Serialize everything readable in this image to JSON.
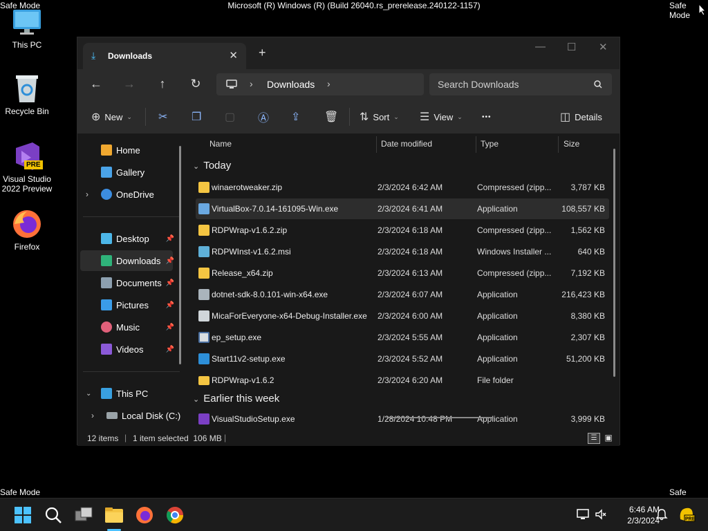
{
  "safe_mode": {
    "top_left": "Safe Mode",
    "top_right": "Safe Mode",
    "bottom_left": "Safe Mode",
    "bottom_right": "Safe Mode"
  },
  "build": "Microsoft (R) Windows (R) (Build 26040.rs_prerelease.240122-1157)",
  "desktop": {
    "this_pc": "This PC",
    "recycle_bin": "Recycle Bin",
    "visual_studio": "Visual Studio 2022 Preview",
    "vs_badge": "PRE",
    "firefox": "Firefox"
  },
  "window": {
    "tab_title": "Downloads",
    "tab_close": "✕",
    "new_tab": "+",
    "minimize": "—",
    "maximize": "☐",
    "close": "✕"
  },
  "nav": {
    "back": "←",
    "forward": "→",
    "up": "↑",
    "refresh": "↻",
    "crumb": "Downloads",
    "search_placeholder": "Search Downloads"
  },
  "cmd": {
    "new": "New",
    "sort": "Sort",
    "view": "View",
    "more": "•••",
    "details": "Details"
  },
  "sidebar": {
    "home": "Home",
    "gallery": "Gallery",
    "onedrive": "OneDrive",
    "desktop": "Desktop",
    "downloads": "Downloads",
    "documents": "Documents",
    "pictures": "Pictures",
    "music": "Music",
    "videos": "Videos",
    "this_pc": "This PC",
    "local_disk": "Local Disk (C:)"
  },
  "columns": {
    "name": "Name",
    "date": "Date modified",
    "type": "Type",
    "size": "Size"
  },
  "groups": {
    "today": "Today",
    "earlier": "Earlier this week"
  },
  "files": [
    {
      "name": "winaerotweaker.zip",
      "date": "2/3/2024 6:42 AM",
      "type": "Compressed (zipp...",
      "size": "3,787 KB"
    },
    {
      "name": "VirtualBox-7.0.14-161095-Win.exe",
      "date": "2/3/2024 6:41 AM",
      "type": "Application",
      "size": "108,557 KB"
    },
    {
      "name": "RDPWrap-v1.6.2.zip",
      "date": "2/3/2024 6:18 AM",
      "type": "Compressed (zipp...",
      "size": "1,562 KB"
    },
    {
      "name": "RDPWInst-v1.6.2.msi",
      "date": "2/3/2024 6:18 AM",
      "type": "Windows Installer ...",
      "size": "640 KB"
    },
    {
      "name": "Release_x64.zip",
      "date": "2/3/2024 6:13 AM",
      "type": "Compressed (zipp...",
      "size": "7,192 KB"
    },
    {
      "name": "dotnet-sdk-8.0.101-win-x64.exe",
      "date": "2/3/2024 6:07 AM",
      "type": "Application",
      "size": "216,423 KB"
    },
    {
      "name": "MicaForEveryone-x64-Debug-Installer.exe",
      "date": "2/3/2024 6:00 AM",
      "type": "Application",
      "size": "8,380 KB"
    },
    {
      "name": "ep_setup.exe",
      "date": "2/3/2024 5:55 AM",
      "type": "Application",
      "size": "2,307 KB"
    },
    {
      "name": "Start11v2-setup.exe",
      "date": "2/3/2024 5:52 AM",
      "type": "Application",
      "size": "51,200 KB"
    },
    {
      "name": "RDPWrap-v1.6.2",
      "date": "2/3/2024 6:20 AM",
      "type": "File folder",
      "size": ""
    }
  ],
  "partial_file": {
    "name": "VisualStudioSetup.exe",
    "date": "1/28/2024 10:48 PM",
    "type": "Application",
    "size": "3,999 KB"
  },
  "status": {
    "items": "12 items",
    "selected": "1 item selected  106 MB"
  },
  "clock": {
    "time": "6:46 AM",
    "date": "2/3/2024"
  },
  "colors": {
    "accent": "#4cc2ff",
    "folder": "#f4c542",
    "window_bg": "#191919",
    "bar_bg": "#2b2b2b"
  }
}
